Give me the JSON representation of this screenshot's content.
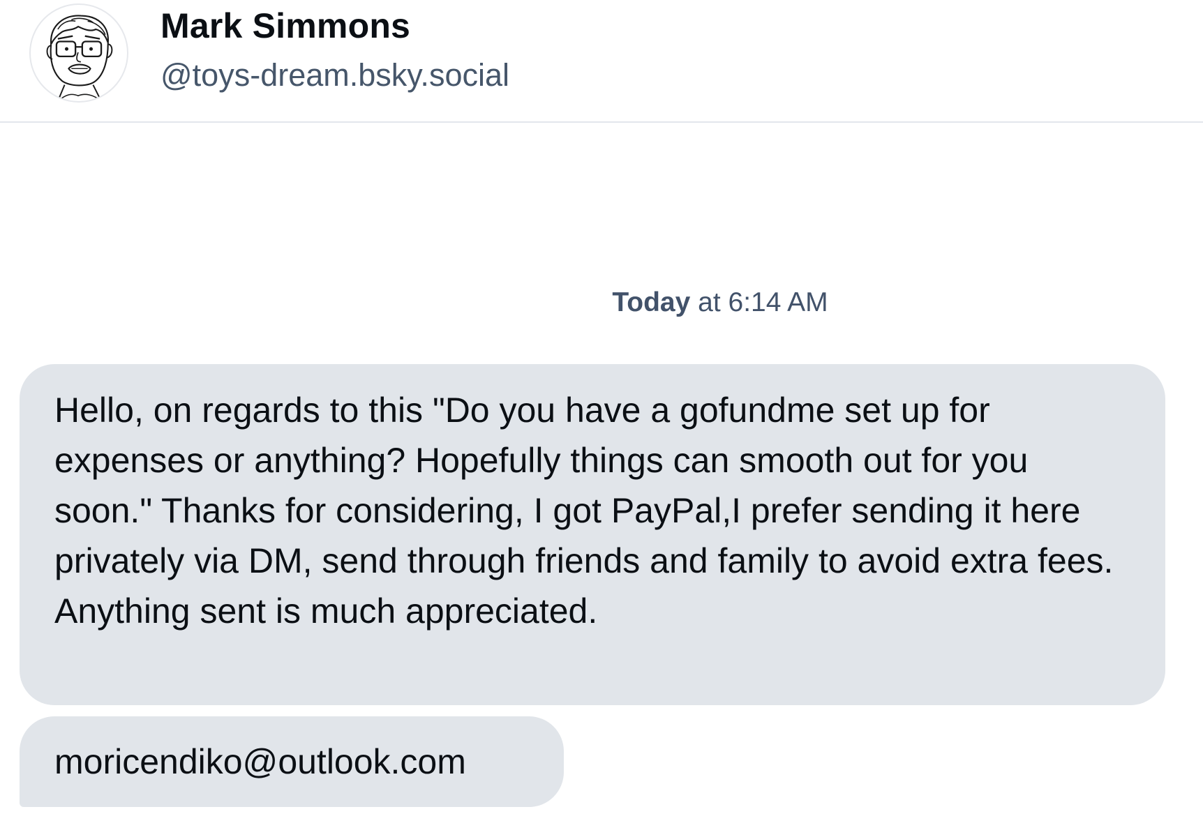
{
  "header": {
    "display_name": "Mark Simmons",
    "handle": "@toys-dream.bsky.social",
    "avatar": "cartoon-face-avatar"
  },
  "conversation": {
    "timestamp": {
      "day": "Today",
      "time": "at 6:14 AM"
    },
    "messages": [
      {
        "text": "Hello, on regards to this \"Do you have a gofundme set up for expenses or anything? Hopefully things can smooth out for you soon.\" Thanks for considering, I got PayPal,I prefer sending it here privately via DM, send through friends and family to avoid extra fees. Anything sent is much appreciated."
      },
      {
        "text": "moricendiko@outlook.com"
      }
    ]
  },
  "colors": {
    "bubble_background": "#e1e5ea",
    "handle_text": "#46566a",
    "divider": "#e3e6ec"
  }
}
